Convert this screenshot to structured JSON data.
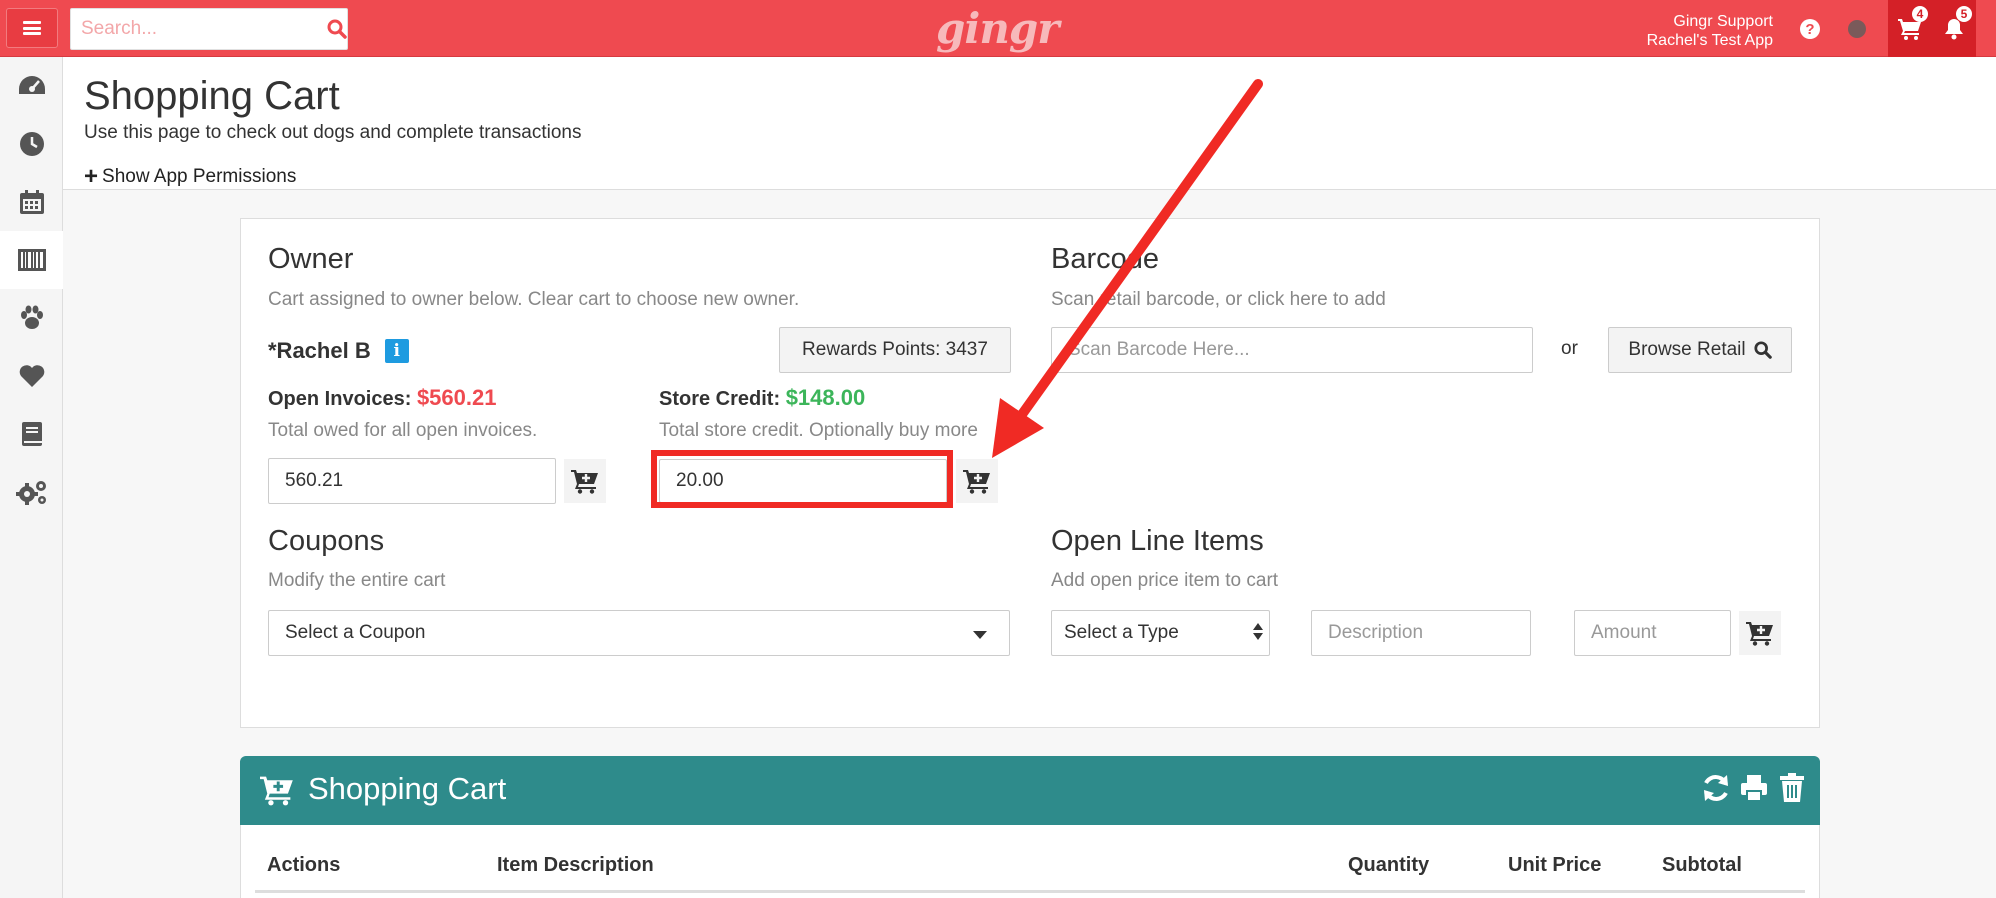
{
  "topbar": {
    "search_placeholder": "Search...",
    "logo": "gingr",
    "support_line1": "Gingr Support",
    "support_line2": "Rachel's Test App",
    "help_glyph": "?",
    "cart_count": "4",
    "notification_count": "5"
  },
  "sidebar": {
    "items": [
      "dashboard-icon",
      "clock-icon",
      "calendar-icon",
      "barcode-icon",
      "paw-icon",
      "heart-icon",
      "book-icon",
      "gears-icon"
    ],
    "active": "barcode-icon"
  },
  "page": {
    "title": "Shopping Cart",
    "subtitle": "Use this page to check out dogs and complete transactions",
    "permissions_link": "Show App Permissions"
  },
  "owner": {
    "heading": "Owner",
    "desc": "Cart assigned to owner below. Clear cart to choose new owner.",
    "name": "*Rachel B",
    "info_glyph": "i",
    "rewards_label": "Rewards Points: 3437",
    "open_invoices_label": "Open Invoices:",
    "open_invoices_value": "$560.21",
    "open_invoices_desc": "Total owed for all open invoices.",
    "open_invoices_input": "560.21",
    "store_credit_label": "Store Credit:",
    "store_credit_value": "$148.00",
    "store_credit_desc": "Total store credit. Optionally buy more",
    "store_credit_input": "20.00"
  },
  "barcode": {
    "heading": "Barcode",
    "desc": "Scan retail barcode, or click here to add",
    "placeholder": "Scan Barcode Here...",
    "or": "or",
    "browse_label": "Browse Retail"
  },
  "coupons": {
    "heading": "Coupons",
    "desc": "Modify the entire cart",
    "select_value": "Select a Coupon"
  },
  "open_line_items": {
    "heading": "Open Line Items",
    "desc": "Add open price item to cart",
    "type_value": "Select a Type",
    "description_placeholder": "Description",
    "amount_placeholder": "Amount"
  },
  "cart": {
    "title": "Shopping Cart",
    "columns": [
      "Actions",
      "Item Description",
      "Quantity",
      "Unit Price",
      "Subtotal"
    ]
  },
  "colors": {
    "topbar": "#ef4a50",
    "cart_header": "#2e8b8b",
    "annotation": "#f02a24",
    "negative": "#ef4a50",
    "positive": "#3cb55a"
  }
}
